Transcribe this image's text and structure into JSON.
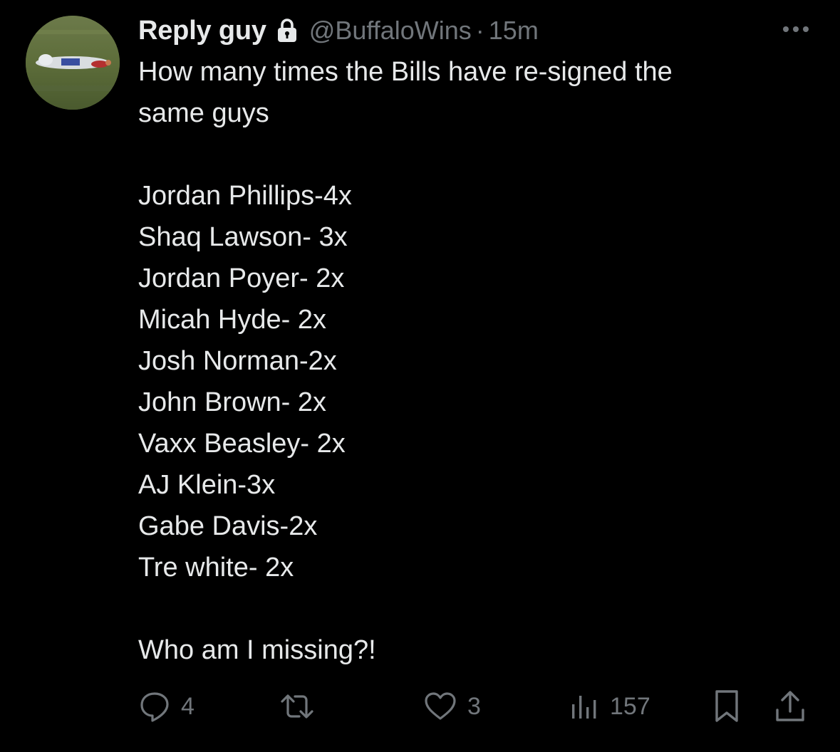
{
  "tweet": {
    "display_name": "Reply guy",
    "handle": "@BuffaloWins",
    "separator": "·",
    "time": "15m",
    "text": {
      "intro": [
        "How many times the Bills have re-signed the",
        "same guys"
      ],
      "list": [
        "Jordan Phillips-4x",
        "Shaq Lawson- 3x",
        "Jordan Poyer- 2x",
        "Micah Hyde- 2x",
        "Josh Norman-2x",
        "John Brown- 2x",
        "Vaxx Beasley- 2x",
        "AJ Klein-3x",
        "Gabe Davis-2x",
        "Tre white- 2x"
      ],
      "outro": "Who am I missing?!"
    }
  },
  "actions": {
    "reply_count": "4",
    "retweet_count": "",
    "like_count": "3",
    "views_count": "157"
  },
  "icons": {
    "lock": "lock-icon",
    "more": "more-icon",
    "reply": "reply-icon",
    "retweet": "retweet-icon",
    "like": "heart-icon",
    "views": "views-icon",
    "bookmark": "bookmark-icon",
    "share": "share-icon"
  },
  "colors": {
    "background": "#000000",
    "text_primary": "#e7e9ea",
    "text_secondary": "#71767b"
  }
}
